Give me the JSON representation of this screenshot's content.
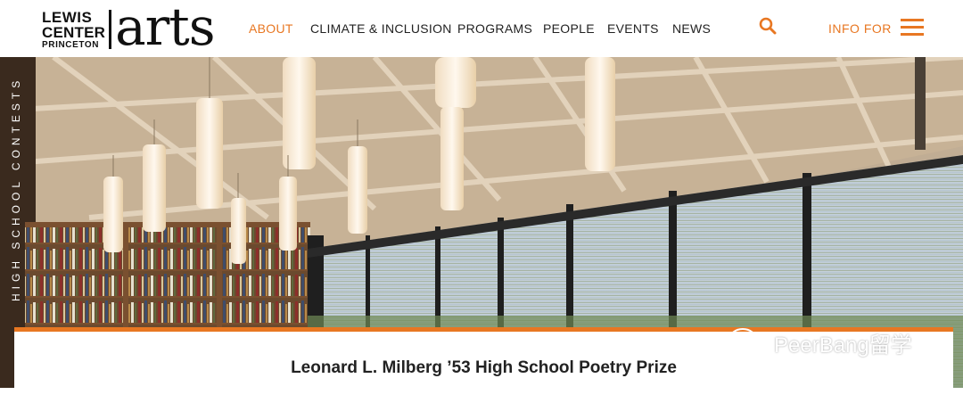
{
  "logo": {
    "line1": "LEWIS",
    "line2": "CENTER",
    "line3": "PRINCETON",
    "wordmark": "arts"
  },
  "nav": [
    {
      "label": "ABOUT",
      "active": true
    },
    {
      "label": "CLIMATE & INCLUSION",
      "active": false
    },
    {
      "label": "PROGRAMS",
      "active": false
    },
    {
      "label": "PEOPLE",
      "active": false
    },
    {
      "label": "EVENTS",
      "active": false
    },
    {
      "label": "NEWS",
      "active": false
    }
  ],
  "search_icon": "search-icon",
  "info_for": "INFO FOR",
  "menu_icon": "hamburger-menu-icon",
  "hero": {
    "section_label": "HIGH SCHOOL CONTESTS"
  },
  "card": {
    "title": "Leonard L. Milberg ’53 High School Poetry Prize"
  },
  "watermark": {
    "text": "PeerBang留学"
  },
  "colors": {
    "accent": "#e87722",
    "text": "#222222"
  }
}
